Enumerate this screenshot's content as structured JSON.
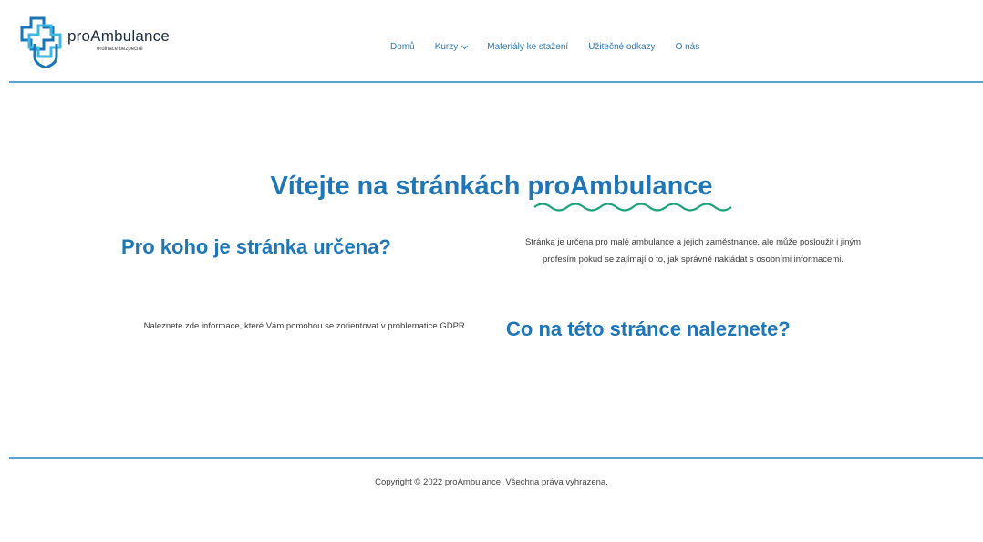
{
  "header": {
    "logo_name": "proAmbulance",
    "logo_tagline": "ordinace bezpečně"
  },
  "nav": {
    "items": [
      {
        "label": "Domů"
      },
      {
        "label": "Kurzy"
      },
      {
        "label": "Materiály ke stažení"
      },
      {
        "label": "Užitečné odkazy"
      },
      {
        "label": "O nás"
      }
    ]
  },
  "main": {
    "hero_title": "Vítejte na stránkách proAmbulance",
    "section1_heading": "Pro koho je stránka určena?",
    "section1_text": "Stránka je určena pro malé ambulance a jejich zaměstnance, ale může posloužit i jiným profesím pokud se zajímají o to, jak správně nakládat s osobními informacemi.",
    "section2_text": "Naleznete zde informace, které Vám pomohou se zorientovat v problematice GDPR.",
    "section2_heading": "Co na této stránce naleznete?"
  },
  "footer": {
    "copyright": "Copyright © 2022 proAmbulance. Všechna práva vyhrazena."
  },
  "colors": {
    "accent": "#1f76b6",
    "rule": "#5aa0d2",
    "squiggle": "#1aa37a"
  }
}
